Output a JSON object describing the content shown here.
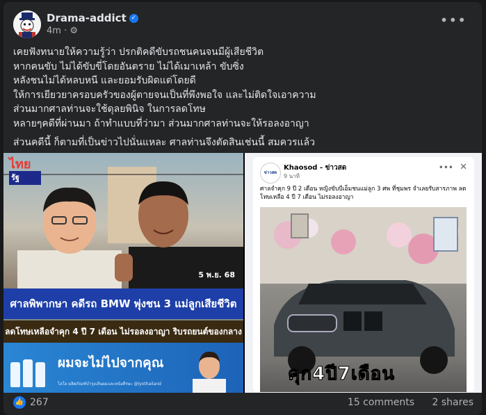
{
  "post": {
    "author": "Drama-addict",
    "time": "4m",
    "privacy_icon": "gear-icon",
    "lines": [
      "เคยฟังทนายให้ความรู้ว่า ปรกติคดีขับรถชนคนจนมีผู้เสียชีวิต",
      "หากคนขับ ไม่ได้ขับขี่โดยอันตราย ไม่ได้เมาเหล้า ขับซิ่ง",
      "หลังชนไม่ได้หลบหนี และยอมรับผิดแต่โดยดี",
      "ให้การเยียวยาครอบครัวของผู้ตายจนเป็นที่พึงพอใจ และไม่ติดใจเอาความ",
      "ส่วนมากศาลท่านจะใช้ดุลยพินิจ ในการลดโทษ",
      "หลายๆคดีที่ผ่านมา ถ้าทำแบบที่ว่ามา ส่วนมากศาลท่านจะให้รอลงอาญา",
      "ส่วนคดีนี้ ก็ตามที่เป็นข่าวไปนั่นแหละ ศาลท่านจึงตัดสินเช่นนี้ สมควรแล้ว"
    ]
  },
  "image_a": {
    "logo_top": "ไทย",
    "logo_bottom": "รัฐ",
    "date": "5 พ.ย. 68",
    "title": "ศาลพิพากษา คดีรถ BMW พุ่งชน 3 แม่ลูกเสียชีวิต",
    "subtitle": "ลดโทษเหลือจำคุก 4 ปี 7 เดือน ไม่รอลงอาญา ริบรถยนต์ของกลาง",
    "ad_headline": "ผมจะไม่ไปจากคุณ",
    "ad_small": "ไลโอ ผลิตภัณฑ์บำรุงเส้นผมและหนังศีรษะ  @lyothailand"
  },
  "image_b": {
    "page_name": "Khaosod - ข่าวสด",
    "avatar_text": "ข่าวสด",
    "time": "9 นาที",
    "text": "ศาลจำคุก 9 ปี 2 เดือน หญิงขับบีเอ็มชนแม่ลูก 3 ศพ ที่ชุมพร จำเลยรับสารภาพ ลดโทษเหลือ 4 ปี 7 เดือน ไม่รอลงอาญา",
    "caption": "คุก4ปี7เดือน"
  },
  "footer": {
    "reactions": "267",
    "comments": "15 comments",
    "shares": "2 shares"
  },
  "colors": {
    "background": "#18191a",
    "card": "#242526",
    "accent": "#1877f2",
    "banner_blue": "#1e3fa8"
  }
}
